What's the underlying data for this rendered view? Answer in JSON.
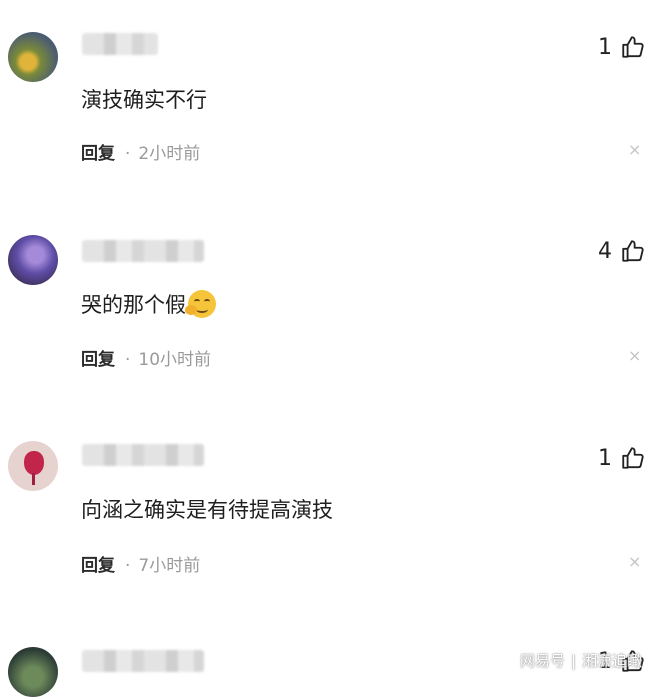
{
  "comments": [
    {
      "text": "演技确实不行",
      "likes": "1",
      "reply": "回复",
      "time": "2小时前"
    },
    {
      "text": "哭的那个假",
      "likes": "4",
      "reply": "回复",
      "time": "10小时前"
    },
    {
      "text": "向涵之确实是有待提高演技",
      "likes": "1",
      "reply": "回复",
      "time": "7小时前"
    },
    {
      "likes": "1"
    }
  ],
  "separator": "·",
  "close_glyph": "×",
  "watermark": {
    "source": "网易号",
    "separator": "|",
    "account": "湘潇追瞰"
  },
  "colors": {
    "meta_gray": "#9a9a9a",
    "emoji_yellow": "#f5c43a"
  }
}
